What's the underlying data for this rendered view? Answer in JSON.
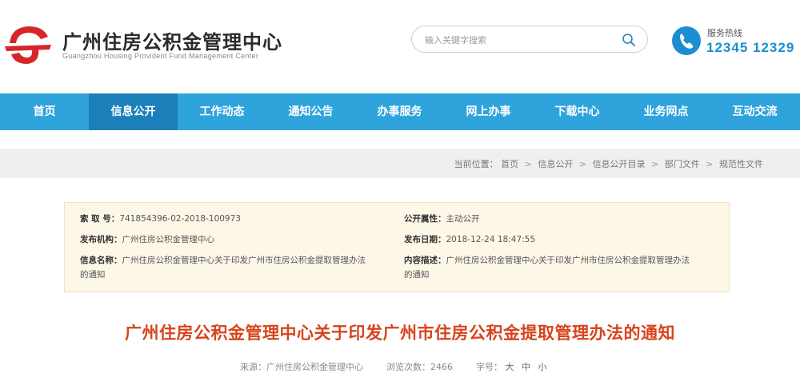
{
  "header": {
    "title_cn": "广州住房公积金管理中心",
    "title_en": "Guangzhou Housing Provident Fund Management Center",
    "search_placeholder": "输入关键字搜索",
    "hotline_label": "服务热线",
    "hotline_number": "12345 12329"
  },
  "nav": {
    "items": [
      {
        "label": "首页"
      },
      {
        "label": "信息公开"
      },
      {
        "label": "工作动态"
      },
      {
        "label": "通知公告"
      },
      {
        "label": "办事服务"
      },
      {
        "label": "网上办事"
      },
      {
        "label": "下载中心"
      },
      {
        "label": "业务网点"
      },
      {
        "label": "互动交流"
      }
    ],
    "active_index": 1
  },
  "breadcrumb": {
    "prefix": "当前位置：",
    "items": [
      "首页",
      "信息公开",
      "信息公开目录",
      "部门文件",
      "规范性文件"
    ],
    "separator": ">"
  },
  "info": {
    "index_no_label": "索 取 号：",
    "index_no": "741854396-02-2018-100973",
    "publicity_label": "公开属性：",
    "publicity": "主动公开",
    "publisher_label": "发布机构：",
    "publisher": "广州住房公积金管理中心",
    "date_label": "发布日期：",
    "date": "2018-12-24 18:47:55",
    "info_name_label": "信息名称：",
    "info_name_1": "广州住房公积金管理中心关于印发广州市住房公积金提取管理办法",
    "info_name_2": "的通知",
    "content_label": "内容描述：",
    "content_1": "广州住房公积金管理中心关于印发广州市住房公积金提取管理办法",
    "content_2": "的通知"
  },
  "article": {
    "title": "广州住房公积金管理中心关于印发广州市住房公积金提取管理办法的通知",
    "source_label": "来源：",
    "source": "广州住房公积金管理中心",
    "views_label": "浏览次数：",
    "views": "2466",
    "font_label": "字号：",
    "font_sizes": [
      "大",
      "中",
      "小"
    ]
  },
  "colors": {
    "nav_bg": "#2fa3dc",
    "nav_active": "#1b7fba",
    "title_red": "#d8431c",
    "hotline_blue": "#1a8ed0",
    "logo_red": "#d7262b"
  }
}
